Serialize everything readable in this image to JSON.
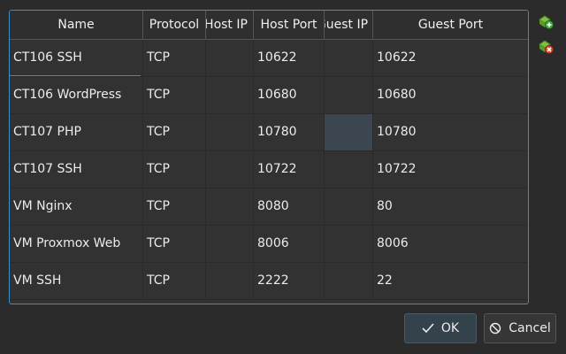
{
  "table": {
    "columns": [
      "Name",
      "Protocol",
      "Host IP",
      "Host Port",
      "Guest IP",
      "Guest Port"
    ],
    "rows": [
      {
        "name": "CT106 SSH",
        "protocol": "TCP",
        "host_ip": "",
        "host_port": "10622",
        "guest_ip": "",
        "guest_port": "10622"
      },
      {
        "name": "CT106 WordPress",
        "protocol": "TCP",
        "host_ip": "",
        "host_port": "10680",
        "guest_ip": "",
        "guest_port": "10680"
      },
      {
        "name": "CT107 PHP",
        "protocol": "TCP",
        "host_ip": "",
        "host_port": "10780",
        "guest_ip": "",
        "guest_port": "10780"
      },
      {
        "name": "CT107 SSH",
        "protocol": "TCP",
        "host_ip": "",
        "host_port": "10722",
        "guest_ip": "",
        "guest_port": "10722"
      },
      {
        "name": "VM Nginx",
        "protocol": "TCP",
        "host_ip": "",
        "host_port": "8080",
        "guest_ip": "",
        "guest_port": "80"
      },
      {
        "name": "VM Proxmox Web",
        "protocol": "TCP",
        "host_ip": "",
        "host_port": "8006",
        "guest_ip": "",
        "guest_port": "8006"
      },
      {
        "name": "VM SSH",
        "protocol": "TCP",
        "host_ip": "",
        "host_port": "2222",
        "guest_ip": "",
        "guest_port": "22"
      }
    ]
  },
  "side_buttons": [
    {
      "icon": "add-rule-icon"
    },
    {
      "icon": "remove-rule-icon"
    }
  ],
  "buttons": {
    "ok_label": "OK",
    "cancel_label": "Cancel"
  },
  "colors": {
    "accent": "#3d8ec2",
    "background": "#2b2b2b",
    "table_bg": "#323232",
    "ok_bg": "#34424c"
  }
}
